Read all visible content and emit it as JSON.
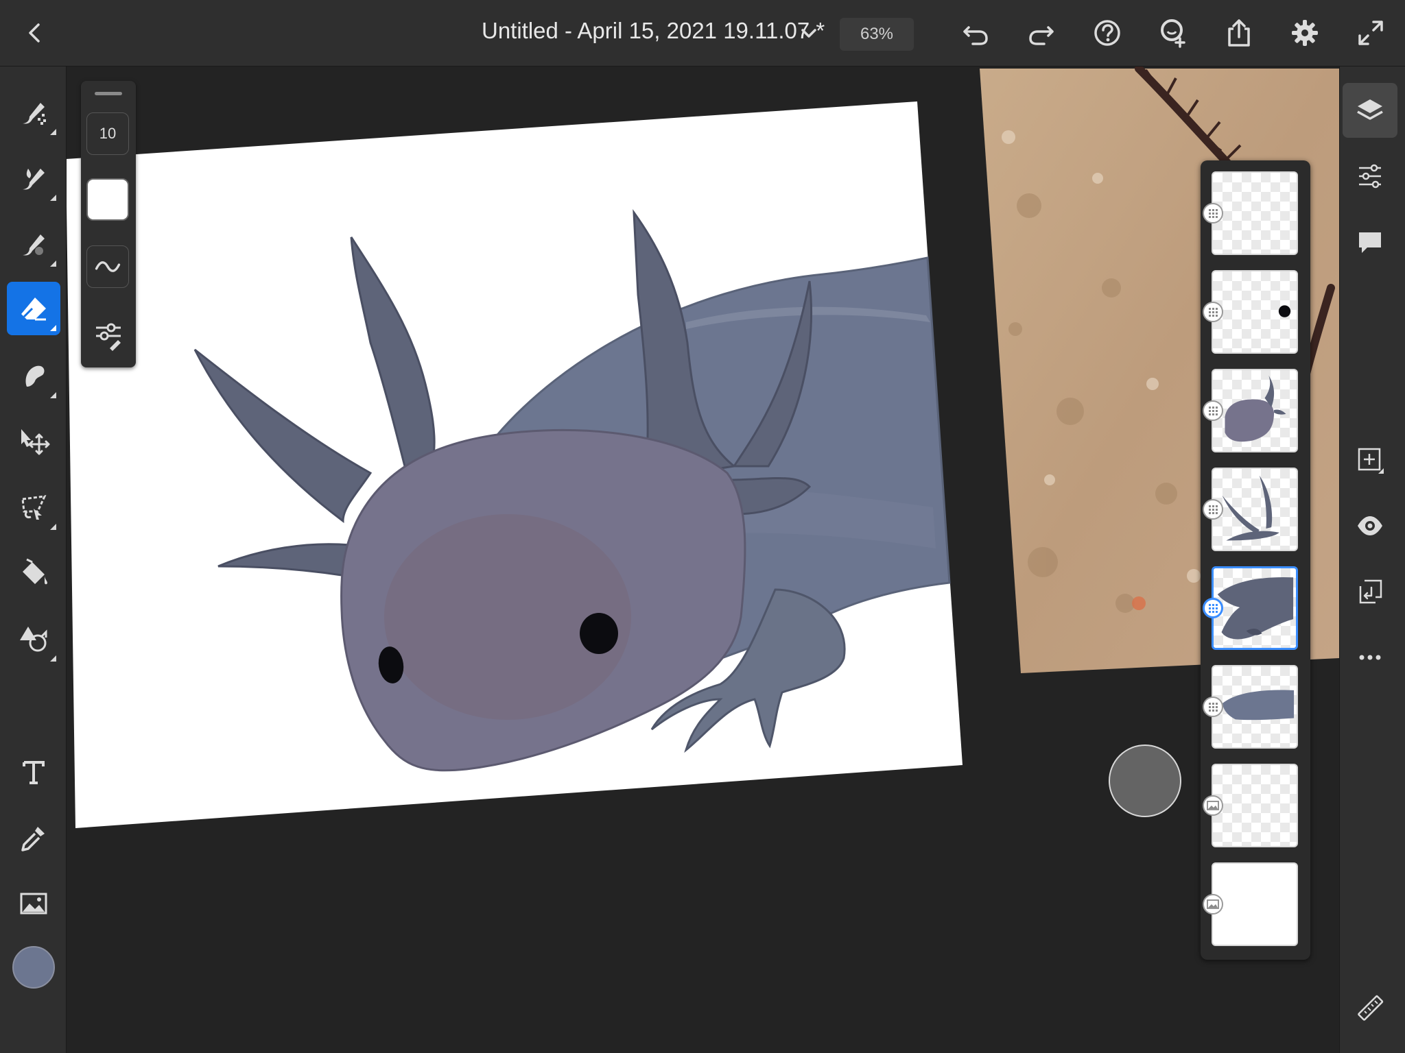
{
  "app": {
    "document_title": "Untitled - April 15, 2021 19.11.07 *",
    "zoom": "63%"
  },
  "topbar": {
    "icons": [
      "back-icon",
      "chevron-down-icon",
      "undo-icon",
      "redo-icon",
      "help-icon",
      "invite-icon",
      "share-icon",
      "settings-icon",
      "fullscreen-icon"
    ]
  },
  "left_toolbar": {
    "tools": [
      {
        "name": "pixel-brush-tool",
        "active": false
      },
      {
        "name": "live-brush-tool",
        "active": false
      },
      {
        "name": "vector-brush-tool",
        "active": false
      },
      {
        "name": "eraser-tool",
        "active": true
      },
      {
        "name": "smudge-tool",
        "active": false
      },
      {
        "name": "transform-tool",
        "active": false
      },
      {
        "name": "lasso-tool",
        "active": false
      },
      {
        "name": "fill-tool",
        "active": false
      },
      {
        "name": "shapes-tool",
        "active": false
      },
      {
        "name": "text-tool",
        "active": false
      },
      {
        "name": "eyedropper-tool",
        "active": false
      },
      {
        "name": "image-tool",
        "active": false
      }
    ],
    "current_color": "#6c7690"
  },
  "brush_panel": {
    "size": "10",
    "opacity_color": "#ffffff"
  },
  "right_toolbar": {
    "tools": [
      "layers",
      "layer-properties",
      "comments",
      "add-layer",
      "visibility",
      "merge-down",
      "more-options",
      "ruler"
    ]
  },
  "layers": [
    {
      "type": "pixel",
      "thumb": "empty",
      "selected": false
    },
    {
      "type": "pixel",
      "thumb": "eye-dot",
      "selected": false
    },
    {
      "type": "pixel",
      "thumb": "head",
      "selected": false
    },
    {
      "type": "pixel",
      "thumb": "gills",
      "selected": false
    },
    {
      "type": "pixel",
      "thumb": "body",
      "selected": true
    },
    {
      "type": "pixel",
      "thumb": "body-stroke",
      "selected": false
    },
    {
      "type": "image",
      "thumb": "empty",
      "selected": false
    },
    {
      "type": "image",
      "thumb": "white",
      "selected": false
    }
  ],
  "colors": {
    "accent": "#1473e6",
    "axolotl_body": "#6c7690",
    "axolotl_head": "#76738c",
    "eye": "#0c0c10"
  }
}
